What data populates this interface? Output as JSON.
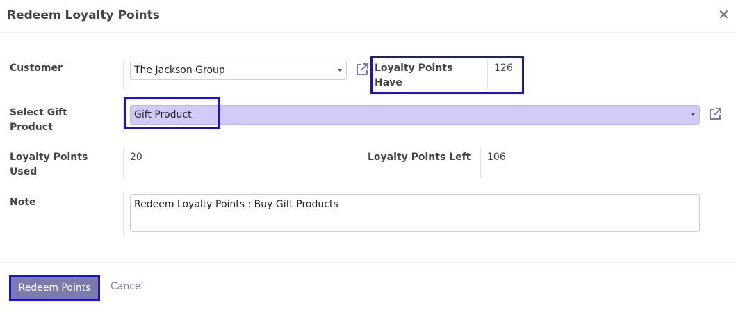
{
  "dialog": {
    "title": "Redeem Loyalty Points",
    "close_label": "×"
  },
  "form": {
    "customer": {
      "label": "Customer",
      "value": "The Jackson Group"
    },
    "loyalty_points_have": {
      "label": "Loyalty Points Have",
      "value": "126"
    },
    "gift_product": {
      "label": "Select Gift Product",
      "value": "Gift Product"
    },
    "loyalty_points_used": {
      "label": "Loyalty Points Used",
      "value": "20"
    },
    "loyalty_points_left": {
      "label": "Loyalty Points Left",
      "value": "106"
    },
    "note": {
      "label": "Note",
      "value": "Redeem Loyalty Points : Buy Gift Products"
    }
  },
  "footer": {
    "redeem_label": "Redeem Points",
    "cancel_label": "Cancel"
  },
  "icons": {
    "external_link": "external-link-icon",
    "dropdown": "chevron-down-icon",
    "close": "close-icon"
  },
  "colors": {
    "primary": "#7c7bad",
    "highlight_border": "#1a13c9",
    "selected_field_bg": "#d0ccf7"
  }
}
